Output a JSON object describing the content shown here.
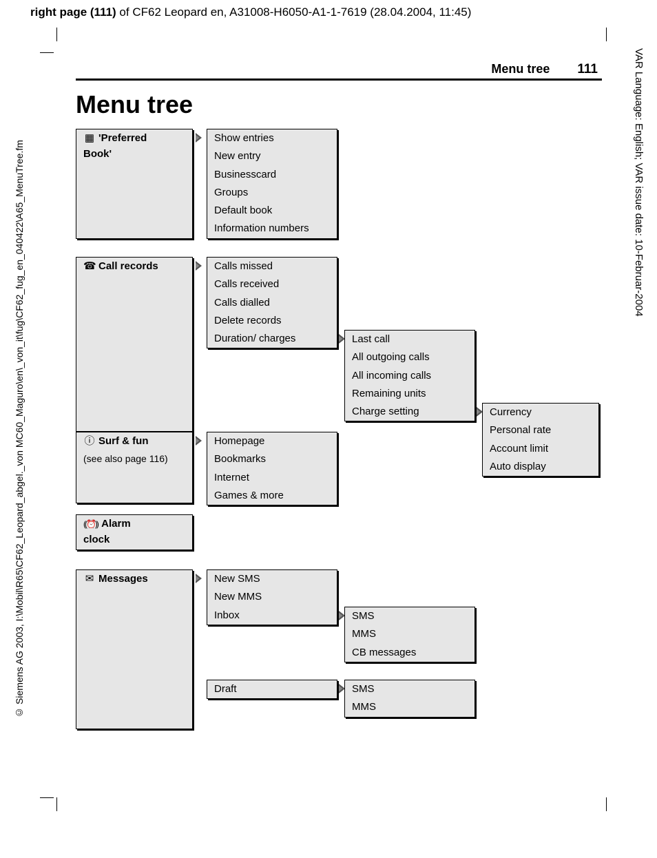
{
  "top_header": {
    "bold": "right page (111)",
    "rest": " of CF62 Leopard en, A31008-H6050-A1-1-7619 (28.04.2004, 11:45)"
  },
  "side_left": "© Siemens AG 2003, I:\\Mobil\\R65\\CF62_Leopard_abgel._von MC60_Maguro\\en\\_von_it\\fug\\CF62_fug_en_040422\\A65_MenuTree.fm",
  "side_right": "VAR Language: English; VAR issue date: 10-Februar-2004",
  "running": {
    "title": "Menu tree",
    "page": "111"
  },
  "h1": "Menu tree",
  "tree": {
    "preferred": {
      "icon": "▦",
      "label1": "'Preferred",
      "label2": "Book'",
      "items": [
        "Show entries",
        "New entry",
        "Businesscard",
        "Groups",
        "Default book",
        "Information numbers"
      ]
    },
    "callrecords": {
      "icon": "☎",
      "label": "Call records",
      "items": [
        "Calls missed",
        "Calls received",
        "Calls dialled",
        "Delete records",
        "Duration/ charges"
      ],
      "duration_sub": [
        "Last call",
        "All outgoing calls",
        "All incoming calls",
        "Remaining units",
        "Charge setting"
      ],
      "charge_sub": [
        "Currency",
        "Personal rate",
        "Account limit",
        "Auto display"
      ]
    },
    "surf": {
      "icon": "ⓘ",
      "label": "Surf & fun",
      "note": "(see also page 116)",
      "items": [
        "Homepage",
        "Bookmarks",
        "Internet",
        "Games & more"
      ]
    },
    "alarm": {
      "icon": "((⏰))",
      "label1": "Alarm",
      "label2": "clock"
    },
    "messages": {
      "icon": "✉",
      "label": "Messages",
      "items": [
        "New SMS",
        "New MMS",
        "Inbox",
        "",
        "",
        "Draft"
      ],
      "inbox_sub": [
        "SMS",
        "MMS",
        "CB messages"
      ],
      "draft_sub": [
        "SMS",
        "MMS"
      ]
    }
  }
}
